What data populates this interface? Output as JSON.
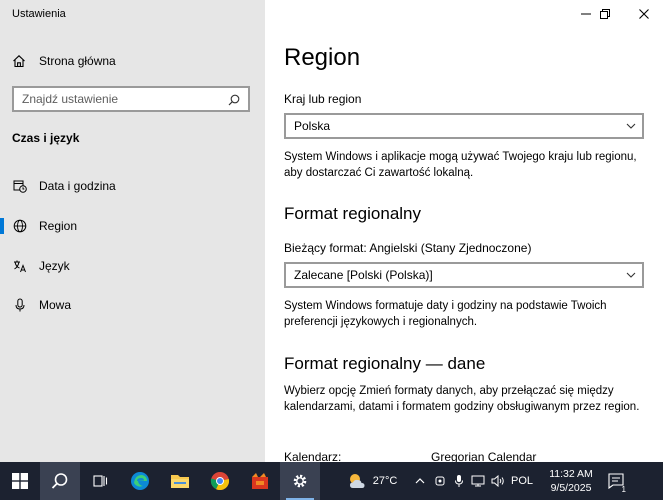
{
  "window": {
    "title": "Ustawienia"
  },
  "sidebar": {
    "home_label": "Strona główna",
    "search_placeholder": "Znajdź ustawienie",
    "section_title": "Czas i język",
    "items": [
      {
        "label": "Data i godzina",
        "icon": "calendar-clock-icon",
        "active": false
      },
      {
        "label": "Region",
        "icon": "globe-icon",
        "active": true
      },
      {
        "label": "Język",
        "icon": "language-icon",
        "active": false
      },
      {
        "label": "Mowa",
        "icon": "microphone-icon",
        "active": false
      }
    ]
  },
  "main": {
    "title": "Region",
    "country_label": "Kraj lub region",
    "country_value": "Polska",
    "country_desc": "System Windows i aplikacje mogą używać Twojego kraju lub regionu, aby dostarczać Ci zawartość lokalną.",
    "format_heading": "Format regionalny",
    "current_format_label": "Bieżący format: Angielski (Stany Zjednoczone)",
    "format_value": "Zalecane [Polski (Polska)]",
    "format_desc": "System Windows formatuje daty i godziny na podstawie Twoich preferencji językowych i regionalnych.",
    "format_data_heading": "Format regionalny — dane",
    "format_data_desc": "Wybierz opcję Zmień formaty danych, aby przełączać się między kalendarzami, datami i formatem godziny obsługiwanym przez region.",
    "calendar_label": "Kalendarz:",
    "calendar_value": "Gregorian Calendar"
  },
  "taskbar": {
    "weather_temp": "27°C",
    "language": "POL",
    "time": "11:32 AM",
    "date": "9/5/2025",
    "notification_count": "1"
  },
  "colors": {
    "accent": "#0078d7",
    "taskbar": "#1c2230",
    "sidebar": "#e6e6e6"
  }
}
